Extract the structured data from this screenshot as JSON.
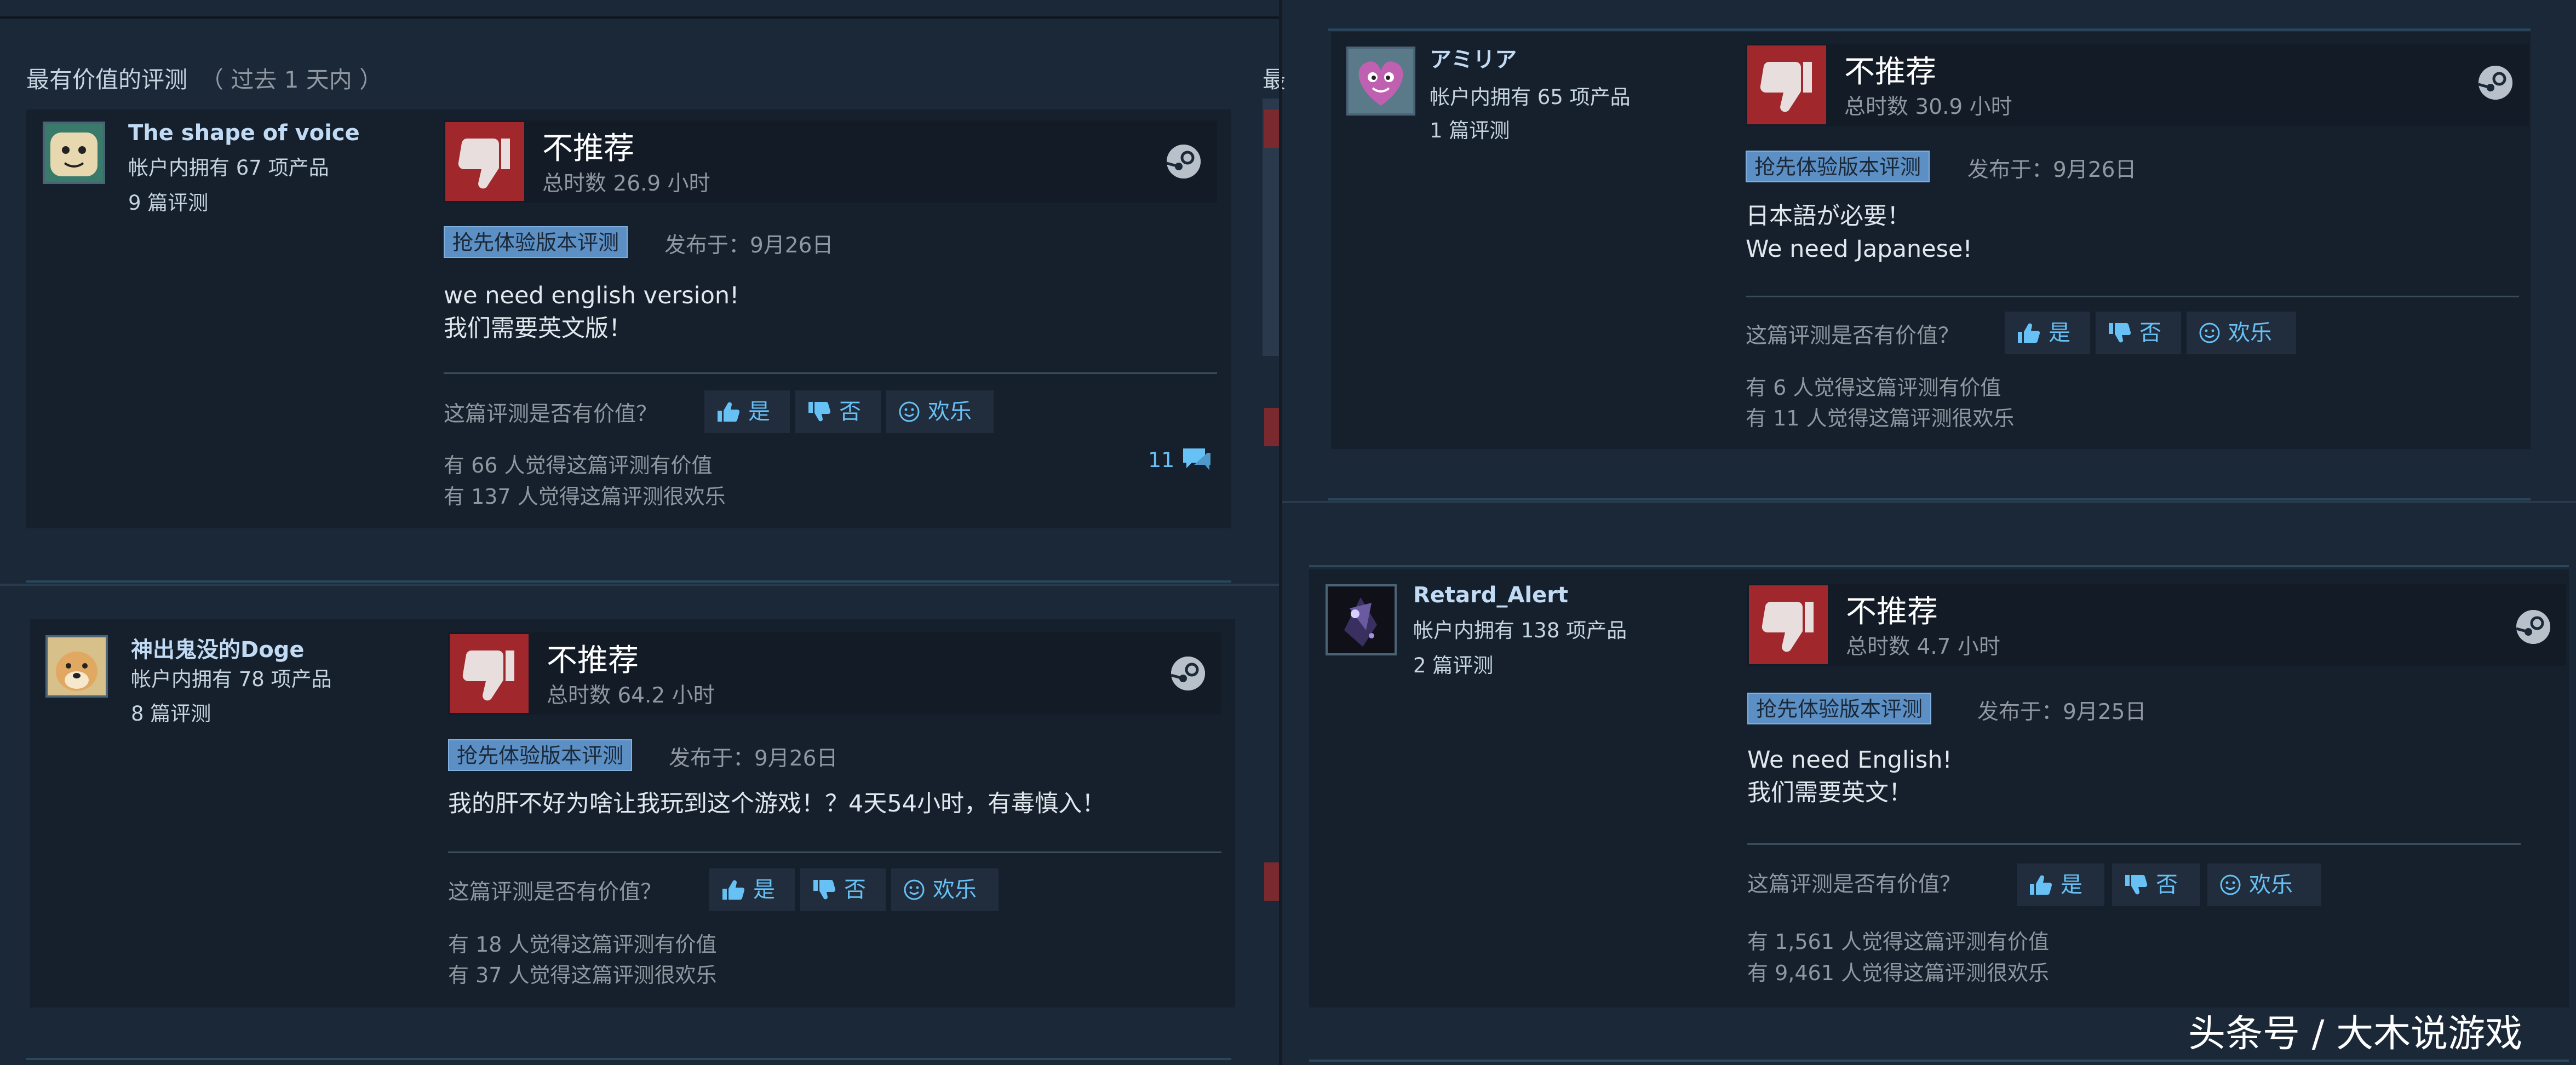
{
  "section": {
    "title": "最有价值的评测",
    "subtitle": "（ 过去 1 天内 ）",
    "title_clip": "最"
  },
  "reviews": [
    {
      "user": "The shape of voice",
      "products": "帐户内拥有 67 项产品",
      "review_count": "9 篇评测",
      "verdict": "不推荐",
      "hours": "总时数 26.9 小时",
      "badge": "抢先体验版本评测",
      "posted": "发布于：9月26日",
      "text": "we need english version!\n我们需要英文版！",
      "helpful_q": "这篇评测是否有价值？",
      "yes": "是",
      "no": "否",
      "funny": "欢乐",
      "helpful_stat": "有 66 人觉得这篇评测有价值",
      "funny_stat": "有 137 人觉得这篇评测很欢乐",
      "comments": "11"
    },
    {
      "user": "神出鬼没的Doge",
      "products": "帐户内拥有 78 项产品",
      "review_count": "8 篇评测",
      "verdict": "不推荐",
      "hours": "总时数 64.2 小时",
      "badge": "抢先体验版本评测",
      "posted": "发布于：9月26日",
      "text": "我的肝不好为啥让我玩到这个游戏！？4天54小时，有毒慎入！",
      "helpful_q": "这篇评测是否有价值？",
      "yes": "是",
      "no": "否",
      "funny": "欢乐",
      "helpful_stat": "有 18 人觉得这篇评测有价值",
      "funny_stat": "有 37 人觉得这篇评测很欢乐"
    },
    {
      "user": "アミリア",
      "products": "帐户内拥有 65 项产品",
      "review_count": "1 篇评测",
      "verdict": "不推荐",
      "hours": "总时数 30.9 小时",
      "badge": "抢先体验版本评测",
      "posted": "发布于：9月26日",
      "text": "日本語が必要！\nWe need Japanese!",
      "helpful_q": "这篇评测是否有价值？",
      "yes": "是",
      "no": "否",
      "funny": "欢乐",
      "helpful_stat": "有 6 人觉得这篇评测有价值",
      "funny_stat": "有 11 人觉得这篇评测很欢乐"
    },
    {
      "user": "Retard_Alert",
      "products": "帐户内拥有 138 项产品",
      "review_count": "2 篇评测",
      "verdict": "不推荐",
      "hours": "总时数 4.7 小时",
      "badge": "抢先体验版本评测",
      "posted": "发布于：9月25日",
      "text": "We need English!\n我们需要英文！",
      "helpful_q": "这篇评测是否有价值？",
      "yes": "是",
      "no": "否",
      "funny": "欢乐",
      "helpful_stat": "有 1,561 人觉得这篇评测有价值",
      "funny_stat": "有 9,461 人觉得这篇评测很欢乐"
    }
  ],
  "watermark": "头条号 / 大木说游戏",
  "colors": {
    "background": "#1b2838",
    "not_recommended": "#a0282c",
    "link": "#67c1f5",
    "badge": "#5c8fc4"
  },
  "icons": [
    "thumbs-down-icon",
    "steam-logo-icon",
    "thumbs-up-icon",
    "smiley-icon",
    "comment-icon"
  ]
}
